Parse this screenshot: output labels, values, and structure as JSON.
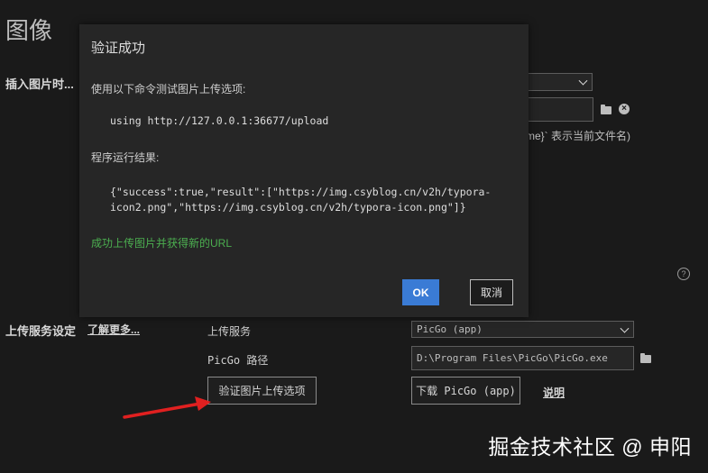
{
  "page": {
    "title": "图像"
  },
  "image_section": {
    "label": "插入图片时...",
    "filename_hint": "me}` 表示当前文件名)"
  },
  "upload_section": {
    "label": "上传服务设定",
    "learn_more": "了解更多...",
    "service_label": "上传服务",
    "service_value": "PicGo (app)",
    "path_label": "PicGo 路径",
    "path_value": "D:\\Program Files\\PicGo\\PicGo.exe",
    "verify_button": "验证图片上传选项",
    "download_button": "下载 PicGo (app)",
    "help_link": "说明"
  },
  "dialog": {
    "title": "验证成功",
    "intro": "使用以下命令测试图片上传选项:",
    "command": "using http://127.0.0.1:36677/upload",
    "result_label": "程序运行结果:",
    "result_line1": "{\"success\":true,\"result\":[\"https://img.csyblog.cn/v2h/typora-",
    "result_line2": "icon2.png\",\"https://img.csyblog.cn/v2h/typora-icon.png\"]}",
    "success_message": "成功上传图片并获得新的URL",
    "ok_button": "OK",
    "cancel_button": "取消"
  },
  "watermark": "掘金技术社区 @ 申阳",
  "colors": {
    "accent": "#3a7bd5",
    "success": "#4caf50",
    "arrow": "#e02020"
  }
}
